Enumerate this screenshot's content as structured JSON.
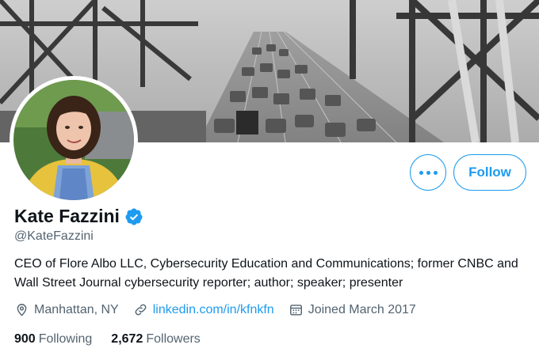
{
  "profile": {
    "display_name": "Kate Fazzini",
    "handle": "@KateFazzini",
    "bio": "CEO of Flore Albo LLC, Cybersecurity Education and Communications; former CNBC and Wall Street Journal cybersecurity reporter; author; speaker; presenter",
    "verified": true
  },
  "actions": {
    "more_icon": "more-dots-icon",
    "follow_label": "Follow"
  },
  "meta": {
    "location": "Manhattan, NY",
    "website": "linkedin.com/in/kfnkfn",
    "joined": "Joined March 2017"
  },
  "stats": {
    "following_count": "900",
    "following_label": "Following",
    "followers_count": "2,672",
    "followers_label": "Followers"
  },
  "colors": {
    "accent": "#1d9bf0",
    "text_primary": "#0f1419",
    "text_secondary": "#536471"
  }
}
